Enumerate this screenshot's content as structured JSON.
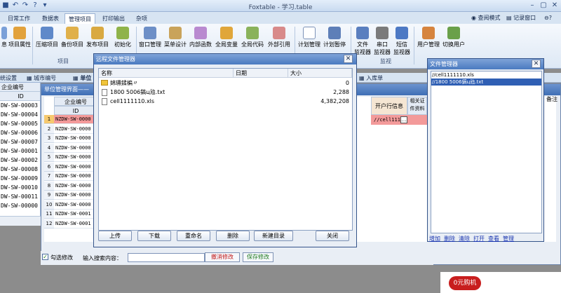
{
  "app": {
    "title": "Foxtable - 学习.table"
  },
  "ribbon_tabs": [
    "日常工作",
    "数据表",
    "管理项目",
    "打印输出",
    "杂项"
  ],
  "ribbon_right": [
    "查阅模式",
    "记录窗口"
  ],
  "ribbon_buttons": [
    {
      "label": "息",
      "icon": "info-icon"
    },
    {
      "label": "项目属性",
      "icon": "properties-icon"
    },
    {
      "label": "压缩项目",
      "icon": "compress-icon"
    },
    {
      "label": "备份项目",
      "icon": "backup-icon"
    },
    {
      "label": "发布项目",
      "icon": "publish-icon"
    },
    {
      "label": "初始化",
      "icon": "init-icon"
    },
    {
      "label": "窗口管理",
      "icon": "window-icon"
    },
    {
      "label": "菜单设计",
      "icon": "menu-design-icon"
    },
    {
      "label": "内部函数",
      "icon": "function-icon"
    },
    {
      "label": "全局变量",
      "icon": "variable-icon"
    },
    {
      "label": "全局代码",
      "icon": "code-icon"
    },
    {
      "label": "外部引用",
      "icon": "reference-icon"
    },
    {
      "label": "计划管理",
      "icon": "calendar-icon"
    },
    {
      "label": "计划暂停",
      "icon": "pause-icon"
    },
    {
      "label": "文件\n监视器",
      "icon": "file-monitor-icon"
    },
    {
      "label": "串口\n监视器",
      "icon": "serial-monitor-icon"
    },
    {
      "label": "短信\n监视器",
      "icon": "sms-monitor-icon"
    },
    {
      "label": "用户管理",
      "icon": "users-icon"
    },
    {
      "label": "切换用户",
      "icon": "switch-user-icon"
    }
  ],
  "ribbon_groups": [
    "项目",
    "监视"
  ],
  "subtabs": [
    "统设置",
    "城市编号",
    "单位",
    "入库单"
  ],
  "left_grid": {
    "header": "企业编号",
    "col": "ID",
    "rows": [
      "DW-SW-00003",
      "DW-SW-00004",
      "DW-SW-00005",
      "DW-SW-00006",
      "DW-SW-00007",
      "DW-SW-00001",
      "DW-SW-00002",
      "DW-SW-00008",
      "DW-SW-00009",
      "DW-SW-00010",
      "DW-SW-00011",
      "DW-SW-00000"
    ]
  },
  "inner_window": {
    "title": "单位管理界面——",
    "col_header": "企业编号",
    "col_id": "ID",
    "rows": [
      "NZDW-SW-0000",
      "NZDW-SW-0000",
      "NZDW-SW-0000",
      "NZDW-SW-0000",
      "NZDW-SW-0000",
      "NZDW-SW-0000",
      "NZDW-SW-0000",
      "NZDW-SW-0000",
      "NZDW-SW-0000",
      "NZDW-SW-0000",
      "NZDW-SW-0001",
      "NZDW-SW-0001"
    ],
    "row_numbers": [
      "1",
      "2",
      "3",
      "4",
      "5",
      "6",
      "7",
      "8",
      "9",
      "10",
      "11",
      "12"
    ],
    "right_cols": [
      "开户行信息",
      "相关证\n件资料",
      "备注"
    ],
    "selected_cell": "//cell1111"
  },
  "remote_dialog": {
    "title": "远程文件管理器",
    "columns": [
      "名称",
      "日期",
      "大小"
    ],
    "files": [
      {
        "name": "婂瓙鍒楄〃",
        "size": "0",
        "icon": "folder-icon"
      },
      {
        "name": "1800 5006鎬ц兘.txt",
        "size": "2,288",
        "icon": "file-icon"
      },
      {
        "name": "cell1111110.xls",
        "size": "4,382,208",
        "icon": "file-icon"
      }
    ],
    "buttons": [
      "上传",
      "下载",
      "重命名",
      "删除",
      "新建目录",
      "关闭"
    ]
  },
  "file_manager": {
    "title": "文件管理器",
    "items": [
      "//cell1111110.xls",
      "//1800 5006鎬ц兘.txt"
    ],
    "links": [
      "增加",
      "删除",
      "清除",
      "打开",
      "查看",
      "管理"
    ]
  },
  "bottom": {
    "checkbox_label": "勾选修改",
    "search_label": "输入搜索内容：",
    "search_value": "",
    "cancel_button": "撤消修改",
    "save_button": "保存修改"
  },
  "ad": {
    "text": "0元购机"
  }
}
